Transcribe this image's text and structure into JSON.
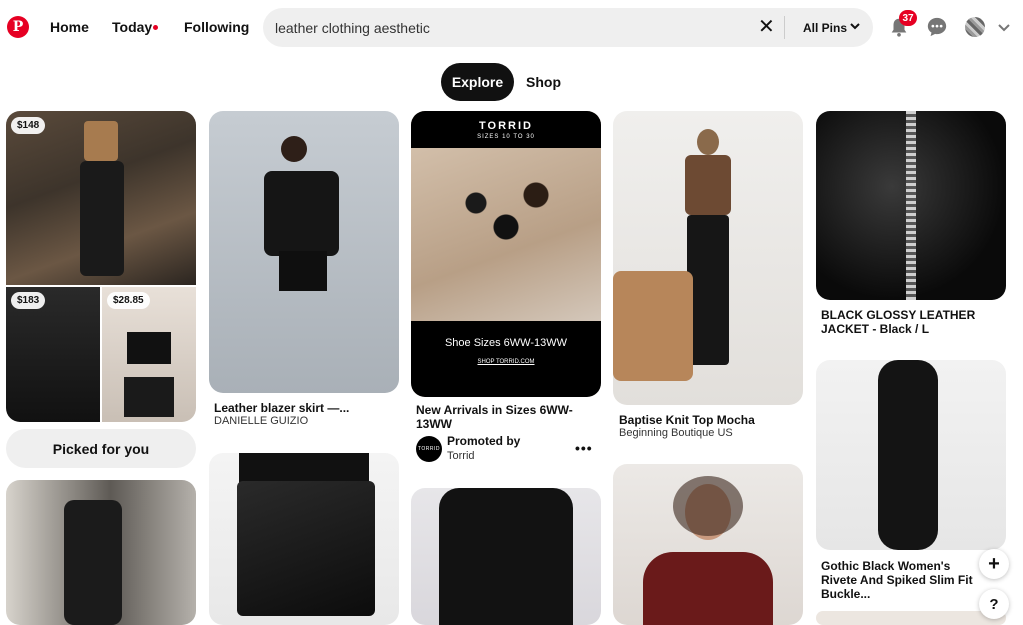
{
  "header": {
    "logo_letter": "P",
    "nav": {
      "home": "Home",
      "today": "Today",
      "following": "Following"
    },
    "search": {
      "query": "leather clothing aesthetic",
      "clear_glyph": "✕",
      "scope": "All Pins"
    },
    "notifications_count": "37",
    "icons": [
      "pinterest-logo",
      "bell-icon",
      "message-icon",
      "avatar",
      "chevron-down-icon",
      "close-icon"
    ]
  },
  "tabs": {
    "explore": "Explore",
    "shop": "Shop"
  },
  "pins": {
    "c1_top": {
      "price_main": "$148",
      "price_left": "$183",
      "price_right": "$28.85"
    },
    "picked": "Picked for you",
    "c2_top": {
      "title": "Leather blazer skirt —...",
      "sub": "DANIELLE GUIZIO"
    },
    "c3_top": {
      "brand": "TORRID",
      "brand_sub": "SIZES 10 TO 30",
      "headline": "Shoe Sizes 6WW-13WW",
      "shop_link": "SHOP TORRID.COM",
      "title": "New Arrivals in Sizes 6WW-13WW",
      "promoted_by": "Promoted by",
      "advertiser": "Torrid",
      "avatar_text": "TORRID",
      "more": "•••"
    },
    "c4_top": {
      "title": "Baptise Knit Top Mocha",
      "sub": "Beginning Boutique US"
    },
    "c5_top": {
      "title": "BLACK GLOSSY LEATHER JACKET - Black / L"
    },
    "c5_mid": {
      "title": "Gothic Black Women's Rivete And Spiked Slim Fit Buckle..."
    }
  },
  "fab": {
    "plus": "+",
    "help": "?"
  },
  "colors": {
    "brand_red": "#e60023",
    "pill_bg": "#efefef",
    "active_tab": "#111111"
  }
}
